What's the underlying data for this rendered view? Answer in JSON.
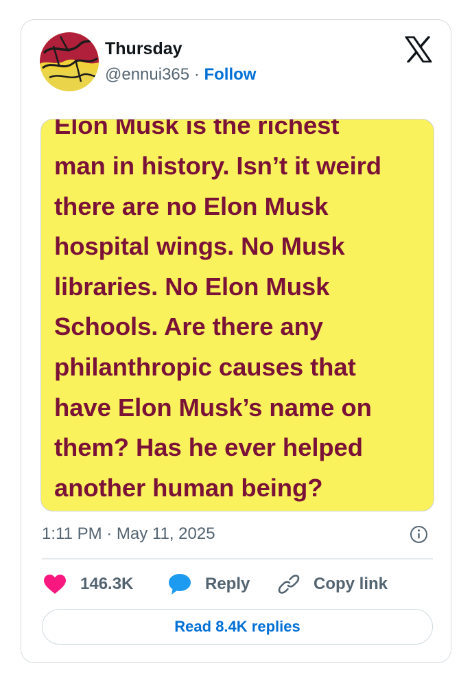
{
  "author": {
    "display_name": "Thursday",
    "handle": "@ennui365",
    "separator": "·",
    "follow_label": "Follow"
  },
  "media": {
    "background_color": "#f9f25c",
    "text_color": "#7a1137",
    "lines": [
      "Elon Musk is the richest",
      "man in history. Isn’t it weird",
      "there are no Elon Musk",
      "hospital wings. No Musk",
      "libraries. No Elon Musk",
      "Schools. Are there any",
      "philanthropic causes that",
      "have Elon Musk’s name on",
      "them? Has he ever helped",
      "another human being?"
    ]
  },
  "timestamp": "1:11 PM · May 11, 2025",
  "actions": {
    "likes_count": "146.3K",
    "reply_label": "Reply",
    "copy_link_label": "Copy link"
  },
  "read_replies_label": "Read 8.4K replies",
  "icons": {
    "brand": "x-logo-icon",
    "like": "heart-icon",
    "reply": "speech-bubble-icon",
    "copy": "link-icon",
    "info": "info-icon"
  },
  "colors": {
    "accent": "#006fd6",
    "like": "#f91880",
    "reply": "#1d9bf0",
    "muted_text": "#536471",
    "primary_text": "#0f1419"
  }
}
